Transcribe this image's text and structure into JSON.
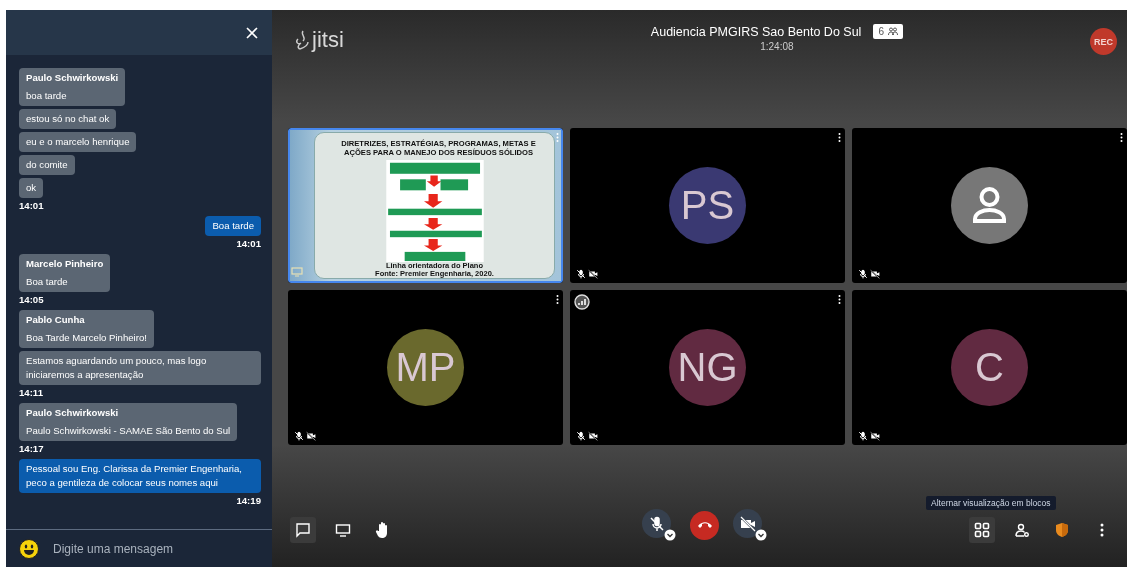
{
  "chat": {
    "messages": [
      {
        "kind": "received",
        "sender": "Paulo Schwirkowski",
        "lines": [
          "boa tarde",
          "estou só no chat ok",
          "eu e o marcelo henrique",
          "do comite",
          "ok"
        ],
        "time": "14:01"
      },
      {
        "kind": "sent",
        "lines": [
          "Boa tarde"
        ],
        "time": "14:01"
      },
      {
        "kind": "received",
        "sender": "Marcelo Pinheiro",
        "lines": [
          "Boa tarde"
        ],
        "time": "14:05"
      },
      {
        "kind": "received",
        "sender": "Pablo Cunha",
        "lines": [
          "Boa Tarde Marcelo Pinheiro!",
          "Estamos aguardando um pouco, mas logo iniciaremos a apresentação"
        ],
        "time": "14:11"
      },
      {
        "kind": "received",
        "sender": "Paulo Schwirkowski",
        "lines": [
          "Paulo Schwirkowski - SAMAE São Bento do Sul"
        ],
        "time": "14:17"
      },
      {
        "kind": "sent",
        "lines": [
          "Pessoal sou Eng. Clarissa da Premier Engenharia, peco a gentileza de colocar seus nomes aqui"
        ],
        "time": "14:19"
      }
    ],
    "input": {
      "placeholder": "Digite uma mensagem"
    }
  },
  "header": {
    "logo": "jitsi",
    "title": "Audiencia PMGIRS Sao Bento Do Sul",
    "participant_count": "6",
    "timer": "1:24:08",
    "recording": "REC"
  },
  "tiles": [
    {
      "kind": "screen",
      "selected": true,
      "muted": false,
      "menu": true,
      "connection_indicator": false,
      "slide_title": [
        "DIRETRIZES, ESTRATÉGIAS, PROGRAMAS, METAS E",
        "AÇÕES PARA O MANEJO DOS RESÍDUOS SÓLIDOS"
      ],
      "caption": [
        "Linha orientadora do Plano",
        "Fonte: Premier Engenharia, 2020."
      ]
    },
    {
      "kind": "avatar",
      "selected": false,
      "muted": true,
      "menu": true,
      "connection_indicator": false,
      "initials": "PS",
      "color": "#3a3972"
    },
    {
      "kind": "placeholder",
      "selected": false,
      "muted": true,
      "menu": true,
      "connection_indicator": false
    },
    {
      "kind": "avatar",
      "selected": false,
      "muted": true,
      "menu": true,
      "connection_indicator": false,
      "initials": "MP",
      "color": "#6a692d"
    },
    {
      "kind": "avatar",
      "selected": false,
      "muted": true,
      "menu": true,
      "connection_indicator": true,
      "initials": "NG",
      "color": "#612a41"
    },
    {
      "kind": "avatar",
      "selected": false,
      "muted": true,
      "menu": false,
      "connection_indicator": false,
      "initials": "C",
      "color": "#612a41"
    }
  ],
  "toolbar": {
    "chat_open": true,
    "mic_muted": true,
    "camera_off": true,
    "tile_view": true,
    "tooltip": "Alternar visualização em blocos"
  }
}
